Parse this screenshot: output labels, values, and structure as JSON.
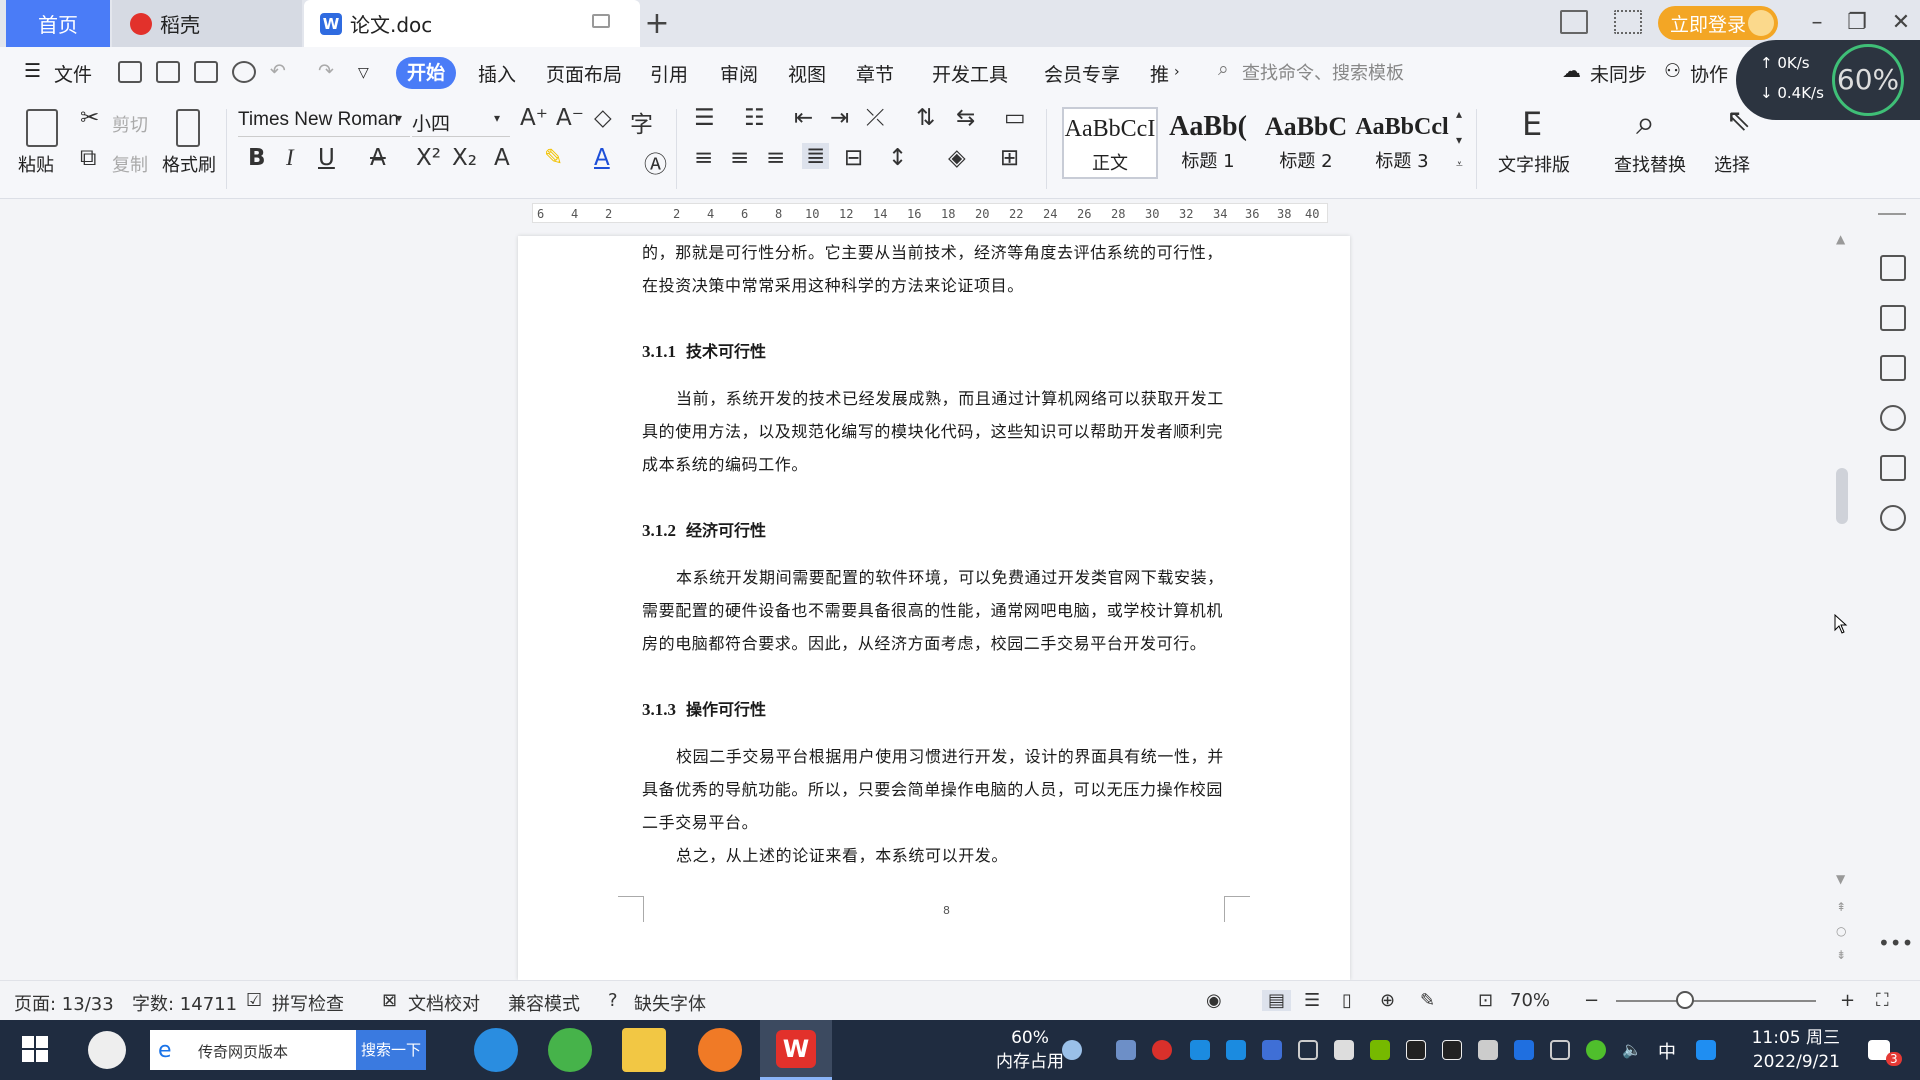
{
  "tabs": {
    "home": "首页",
    "docer": "稻壳",
    "doc": "论文.doc",
    "login": "立即登录"
  },
  "menu": {
    "file": "文件",
    "items": [
      "开始",
      "插入",
      "页面布局",
      "引用",
      "审阅",
      "视图",
      "章节",
      "开发工具",
      "会员专享",
      "推"
    ],
    "search_placeholder": "查找命令、搜索模板",
    "sync": "未同步",
    "collab": "协作"
  },
  "ribbon": {
    "paste": "粘贴",
    "cut": "剪切",
    "copy": "复制",
    "format_painter": "格式刷",
    "font_name": "Times New Roman",
    "font_size": "小四",
    "styles": [
      {
        "sample": "AaBbCcI",
        "name": "正文"
      },
      {
        "sample": "AaBb(",
        "name": "标题 1"
      },
      {
        "sample": "AaBbC",
        "name": "标题 2"
      },
      {
        "sample": "AaBbCcl",
        "name": "标题 3"
      }
    ],
    "text_layout": "文字排版",
    "find_replace": "查找替换",
    "select": "选择"
  },
  "net": {
    "up": "0K/s",
    "down": "0.4K/s",
    "cpu": "60%"
  },
  "ruler_ticks": [
    "6",
    "4",
    "2",
    "2",
    "4",
    "6",
    "8",
    "10",
    "12",
    "14",
    "16",
    "18",
    "20",
    "22",
    "24",
    "26",
    "28",
    "30",
    "32",
    "34",
    "36",
    "38",
    "40"
  ],
  "document": {
    "intro_lines": [
      "的，那就是可行性分析。它主要从当前技术，经济等角度去评估系统的可行性，",
      "在投资决策中常常采用这种科学的方法来论证项目。"
    ],
    "sections": [
      {
        "num": "3.1.1",
        "title": "技术可行性",
        "lines": [
          "当前，系统开发的技术已经发展成熟，而且通过计算机网络可以获取开发工",
          "具的使用方法，以及规范化编写的模块化代码，这些知识可以帮助开发者顺利完",
          "成本系统的编码工作。"
        ]
      },
      {
        "num": "3.1.2",
        "title": "经济可行性",
        "lines": [
          "本系统开发期间需要配置的软件环境，可以免费通过开发类官网下载安装，",
          "需要配置的硬件设备也不需要具备很高的性能，通常网吧电脑，或学校计算机机",
          "房的电脑都符合要求。因此，从经济方面考虑，校园二手交易平台开发可行。"
        ]
      },
      {
        "num": "3.1.3",
        "title": "操作可行性",
        "lines": [
          "校园二手交易平台根据用户使用习惯进行开发，设计的界面具有统一性，并",
          "具备优秀的导航功能。所以，只要会简单操作电脑的人员，可以无压力操作校园",
          "二手交易平台。"
        ]
      }
    ],
    "conclusion": "总之，从上述的论证来看，本系统可以开发。",
    "page_number": "8"
  },
  "status": {
    "page": "页面: 13/33",
    "words": "字数: 14711",
    "spell": "拼写检查",
    "proof": "文档校对",
    "compat": "兼容模式",
    "missing_font": "缺失字体",
    "zoom": "70%"
  },
  "taskbar": {
    "search_text": "传奇网页版本",
    "search_btn": "搜索一下",
    "mem_pct": "60%",
    "mem_label": "内存占用",
    "ime": "中",
    "time": "11:05 周三",
    "date": "2022/9/21",
    "badge": "3"
  },
  "colors": {
    "accent": "#4a7cf7",
    "login": "#f3a625",
    "taskbar": "#1f2c40"
  }
}
